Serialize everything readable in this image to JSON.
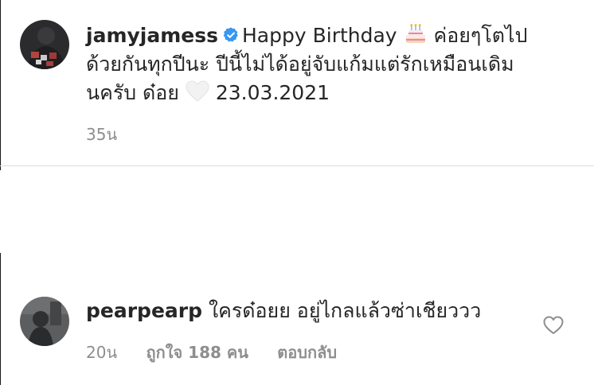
{
  "comments": [
    {
      "username": "jamyjamess",
      "verified": true,
      "text_line1": "Happy Birthday",
      "text_line1_after_emoji": "ค่อยๆโตไป",
      "text_line2": "ด้วยกันทุกปีนะ ปีนี้ไม่ได้อยู่จับแก้มแต่รักเหมือนเดิม",
      "text_line3": "นครับ ด๋อย",
      "text_line3_date": "23.03.2021",
      "emojis": [
        "birthday-cake",
        "white-heart"
      ],
      "time": "35น"
    },
    {
      "username": "pearpearp",
      "text": "ใครด๋อยย อยู่ไกลแล้วซ่าเชียววว",
      "time": "20น",
      "likes": "ถูกใจ 188 คน",
      "reply_label": "ตอบกลับ"
    }
  ],
  "colors": {
    "text": "#262626",
    "secondary": "#8e8e8e",
    "verified_blue": "#3897f0",
    "divider": "#dbdbdb"
  }
}
